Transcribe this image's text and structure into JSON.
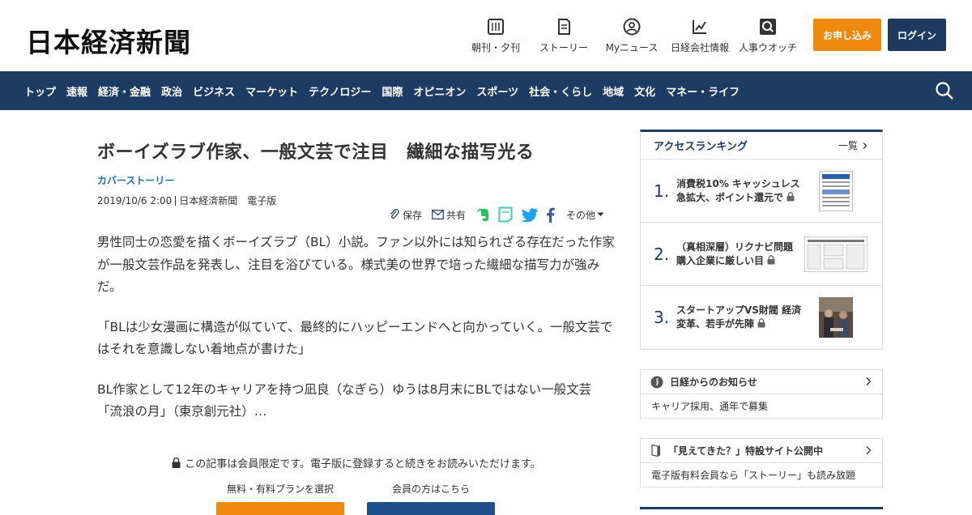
{
  "header": {
    "logo": "日本経済新聞",
    "nav": [
      {
        "label": "朝刊・夕刊",
        "icon": "newspaper-icon"
      },
      {
        "label": "ストーリー",
        "icon": "book-icon"
      },
      {
        "label": "Myニュース",
        "icon": "user-icon"
      },
      {
        "label": "日経会社情報",
        "icon": "chart-icon"
      },
      {
        "label": "人事ウオッチ",
        "icon": "search-icon"
      }
    ],
    "apply_label": "お申し込み",
    "login_label": "ログイン"
  },
  "navbar": {
    "items": [
      "トップ",
      "速報",
      "経済・金融",
      "政治",
      "ビジネス",
      "マーケット",
      "テクノロジー",
      "国際",
      "オピニオン",
      "スポーツ",
      "社会・くらし",
      "地域",
      "文化",
      "マネー・ライフ"
    ]
  },
  "article": {
    "headline": "ボーイズラブ作家、一般文芸で注目　繊細な描写光る",
    "kicker": "カバーストーリー",
    "date": "2019/10/6 2:00",
    "source": "日本経済新聞　電子版",
    "tools": {
      "save": "保存",
      "share": "共有",
      "more": "その他"
    },
    "paragraphs": [
      "男性同士の恋愛を描くボーイズラブ（BL）小説。ファン以外には知られざる存在だった作家が一般文芸作品を発表し、注目を浴びている。様式美の世界で培った繊細な描写力が強みだ。",
      "「BLは少女漫画に構造が似ていて、最終的にハッピーエンドへと向かっていく。一般文芸ではそれを意識しない着地点が書けた」",
      "BL作家として12年のキャリアを持つ凪良（なぎら）ゆうは8月末にBLではない一般文芸「流浪の月」（東京創元社）…"
    ],
    "paywall": {
      "message": "この記事は会員限定です。電子版に登録すると続きをお読みいただけます。",
      "plan_label": "無料・有料プランを選択",
      "member_label": "会員の方はこちら"
    }
  },
  "sidebar": {
    "ranking": {
      "title": "アクセスランキング",
      "all_label": "一覧",
      "items": [
        {
          "rank": "1.",
          "text": "消費税10% キャッシュレス急拡大、ポイント還元で"
        },
        {
          "rank": "2.",
          "text": "（真相深層）リクナビ問題 購入企業に厳しい目"
        },
        {
          "rank": "3.",
          "text": "スタートアップVS財閥 経済変革、若手が先陣"
        }
      ]
    },
    "notice": {
      "title": "日経からのお知らせ",
      "body": "キャリア採用、通年で募集"
    },
    "special": {
      "title": "「見えてきた？」特設サイト公開中",
      "body": "電子版有料会員なら「ストーリー」も読み放題"
    }
  },
  "colors": {
    "navy": "#1d3c63",
    "orange": "#f08a0f",
    "link_blue": "#1d6fb0"
  }
}
